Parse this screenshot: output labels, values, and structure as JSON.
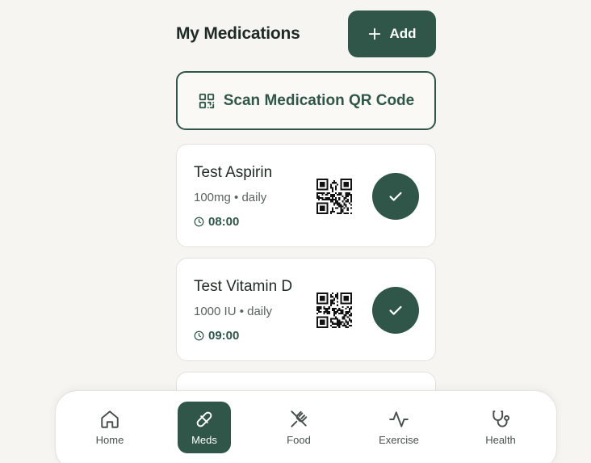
{
  "header": {
    "title": "My Medications",
    "add_label": "Add"
  },
  "scan": {
    "label": "Scan Medication QR Code"
  },
  "medications": [
    {
      "name": "Test Aspirin",
      "dose": "100mg • daily",
      "time": "08:00",
      "taken": true
    },
    {
      "name": "Test Vitamin D",
      "dose": "1000 IU • daily",
      "time": "09:00",
      "taken": true
    }
  ],
  "nav": {
    "items": [
      {
        "label": "Home",
        "icon": "home-icon",
        "active": false
      },
      {
        "label": "Meds",
        "icon": "pill-icon",
        "active": true
      },
      {
        "label": "Food",
        "icon": "utensils-icon",
        "active": false
      },
      {
        "label": "Exercise",
        "icon": "activity-icon",
        "active": false
      },
      {
        "label": "Health",
        "icon": "stethoscope-icon",
        "active": false
      }
    ]
  },
  "colors": {
    "primary": "#2f5648",
    "background": "#f6f5f1",
    "card": "#ffffff",
    "muted_text": "#5b625e"
  }
}
